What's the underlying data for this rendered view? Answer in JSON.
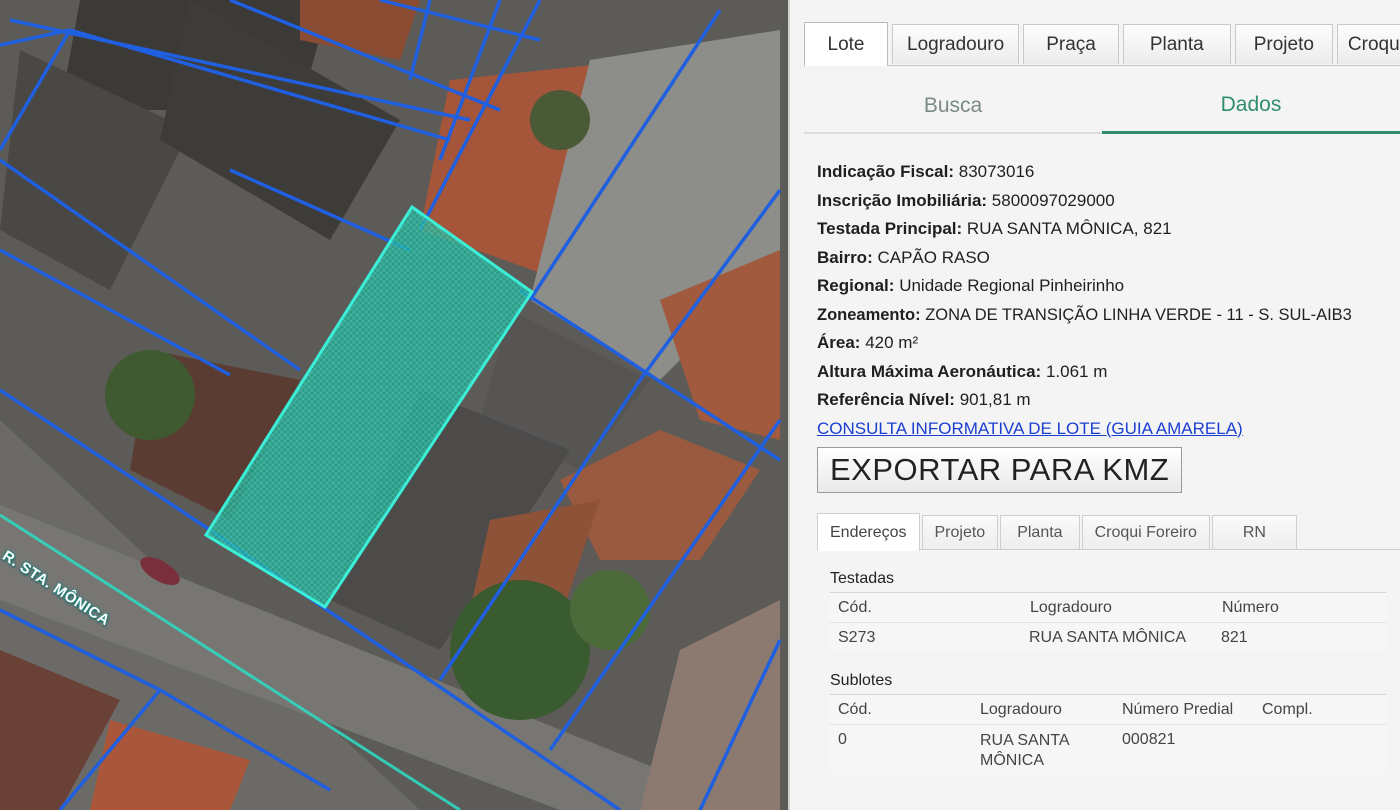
{
  "map": {
    "street_label": "R. STA. MÔNICA"
  },
  "panel": {
    "top_tabs": [
      {
        "label": "Lote",
        "active": true
      },
      {
        "label": "Logradouro",
        "active": false
      },
      {
        "label": "Praça",
        "active": false
      },
      {
        "label": "Planta",
        "active": false
      },
      {
        "label": "Projeto",
        "active": false
      },
      {
        "label": "Croqui Fo",
        "active": false
      }
    ],
    "sub_tabs": [
      {
        "label": "Busca",
        "active": false
      },
      {
        "label": "Dados",
        "active": true
      }
    ],
    "info": {
      "indicacao_fiscal": {
        "label": "Indicação Fiscal:",
        "value": "83073016"
      },
      "inscricao": {
        "label": "Inscrição Imobiliária:",
        "value": "5800097029000"
      },
      "testada": {
        "label": "Testada Principal:",
        "value": "RUA SANTA MÔNICA, 821"
      },
      "bairro": {
        "label": "Bairro:",
        "value": "CAPÃO RASO"
      },
      "regional": {
        "label": "Regional:",
        "value": "Unidade Regional Pinheirinho"
      },
      "zoneamento": {
        "label": "Zoneamento:",
        "value": "ZONA DE TRANSIÇÃO LINHA VERDE - 11 - S. SUL-AIB3"
      },
      "area": {
        "label": "Área:",
        "value": "420 m²"
      },
      "altura": {
        "label": "Altura Máxima Aeronáutica:",
        "value": "1.061 m"
      },
      "referencia": {
        "label": "Referência Nível:",
        "value": "901,81 m"
      },
      "link": "CONSULTA INFORMATIVA DE LOTE (GUIA AMARELA)"
    },
    "export_button": "EXPORTAR PARA KMZ",
    "lower_tabs": [
      {
        "label": "Endereços",
        "active": true
      },
      {
        "label": "Projeto",
        "active": false
      },
      {
        "label": "Planta",
        "active": false
      },
      {
        "label": "Croqui Foreiro",
        "active": false
      },
      {
        "label": "RN",
        "active": false
      }
    ],
    "testadas": {
      "title": "Testadas",
      "headers": {
        "cod": "Cód.",
        "logradouro": "Logradouro",
        "numero": "Número"
      },
      "rows": [
        {
          "cod": "S273",
          "logradouro": "RUA SANTA MÔNICA",
          "numero": "821"
        }
      ]
    },
    "sublotes": {
      "title": "Sublotes",
      "headers": {
        "cod": "Cód.",
        "logradouro": "Logradouro",
        "numero_predial": "Número Predial",
        "compl": "Compl."
      },
      "rows": [
        {
          "cod": "0",
          "logradouro": "RUA SANTA MÔNICA",
          "numero_predial": "000821",
          "compl": ""
        }
      ]
    }
  }
}
